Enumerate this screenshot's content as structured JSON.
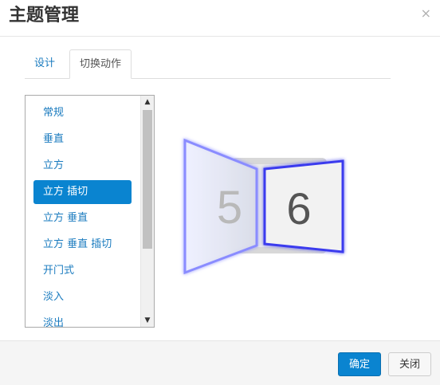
{
  "dialog": {
    "title": "主题管理",
    "close_symbol": "×"
  },
  "tabs": [
    {
      "label": "设计"
    },
    {
      "label": "切换动作"
    }
  ],
  "transitions": {
    "items": [
      "常规",
      "垂直",
      "立方",
      "立方 插切",
      "立方 垂直",
      "立方 垂直 插切",
      "开门式",
      "淡入",
      "淡出"
    ],
    "selected": "立方 插切"
  },
  "preview": {
    "left_number": "5",
    "right_number": "6"
  },
  "footer": {
    "ok_label": "确定",
    "close_label": "关闭"
  }
}
